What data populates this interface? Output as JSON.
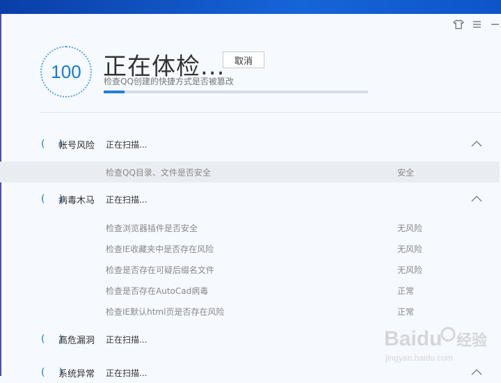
{
  "window": {
    "buttons": [
      {
        "name": "skin-icon",
        "glyph": "👕"
      },
      {
        "name": "menu-icon",
        "glyph": "☰"
      },
      {
        "name": "minimize-icon",
        "glyph": "—"
      }
    ]
  },
  "header": {
    "score": "100",
    "title": "正在体检...",
    "cancel_label": "取消",
    "subtitle": "检查QQ创建的快捷方式是否被篡改",
    "progress_percent": 8
  },
  "categories": [
    {
      "paren": "( )",
      "name": "帐号风险",
      "status": "正在扫描...",
      "items": [
        {
          "desc": "检查QQ目录、文件是否安全",
          "result": "安全"
        }
      ]
    },
    {
      "paren": "( )",
      "name": "病毒木马",
      "status": "正在扫描...",
      "items": [
        {
          "desc": "检查浏览器插件是否安全",
          "result": "无风险"
        },
        {
          "desc": "检查IE收藏夹中是否存在风险",
          "result": "无风险"
        },
        {
          "desc": "检查是否存在可疑后缀名文件",
          "result": "无风险"
        },
        {
          "desc": "检查是否存在AutoCad病毒",
          "result": "正常"
        },
        {
          "desc": "检查IE默认html页是否存在风险",
          "result": "正常"
        }
      ]
    },
    {
      "paren": "( )",
      "name": "高危漏洞",
      "status": "正在扫描..."
    },
    {
      "paren": "( )",
      "name": "系统异常",
      "status": "正在扫描..."
    }
  ],
  "watermark": {
    "brand": "Baidu",
    "cn": "经验",
    "url": "jingyan.baidu.com"
  },
  "colors": {
    "accent": "#1479d6",
    "progress": "#1f7fe0",
    "topbar": "#1565d8"
  }
}
